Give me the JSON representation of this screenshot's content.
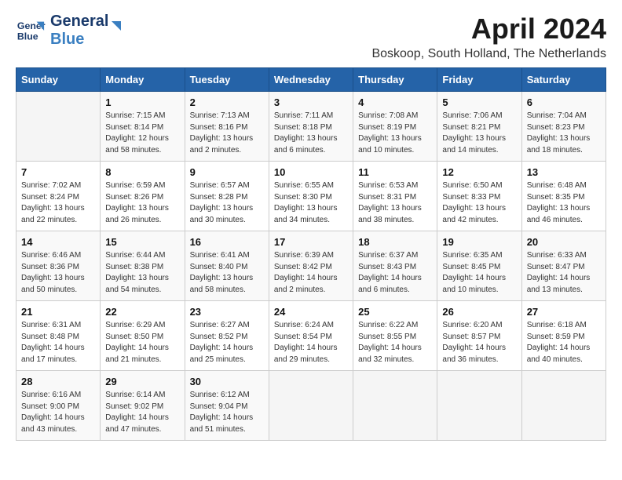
{
  "logo": {
    "line1": "General",
    "line2": "Blue"
  },
  "title": "April 2024",
  "location": "Boskoop, South Holland, The Netherlands",
  "weekdays": [
    "Sunday",
    "Monday",
    "Tuesday",
    "Wednesday",
    "Thursday",
    "Friday",
    "Saturday"
  ],
  "weeks": [
    [
      {
        "day": "",
        "sunrise": "",
        "sunset": "",
        "daylight": ""
      },
      {
        "day": "1",
        "sunrise": "Sunrise: 7:15 AM",
        "sunset": "Sunset: 8:14 PM",
        "daylight": "Daylight: 12 hours and 58 minutes."
      },
      {
        "day": "2",
        "sunrise": "Sunrise: 7:13 AM",
        "sunset": "Sunset: 8:16 PM",
        "daylight": "Daylight: 13 hours and 2 minutes."
      },
      {
        "day": "3",
        "sunrise": "Sunrise: 7:11 AM",
        "sunset": "Sunset: 8:18 PM",
        "daylight": "Daylight: 13 hours and 6 minutes."
      },
      {
        "day": "4",
        "sunrise": "Sunrise: 7:08 AM",
        "sunset": "Sunset: 8:19 PM",
        "daylight": "Daylight: 13 hours and 10 minutes."
      },
      {
        "day": "5",
        "sunrise": "Sunrise: 7:06 AM",
        "sunset": "Sunset: 8:21 PM",
        "daylight": "Daylight: 13 hours and 14 minutes."
      },
      {
        "day": "6",
        "sunrise": "Sunrise: 7:04 AM",
        "sunset": "Sunset: 8:23 PM",
        "daylight": "Daylight: 13 hours and 18 minutes."
      }
    ],
    [
      {
        "day": "7",
        "sunrise": "Sunrise: 7:02 AM",
        "sunset": "Sunset: 8:24 PM",
        "daylight": "Daylight: 13 hours and 22 minutes."
      },
      {
        "day": "8",
        "sunrise": "Sunrise: 6:59 AM",
        "sunset": "Sunset: 8:26 PM",
        "daylight": "Daylight: 13 hours and 26 minutes."
      },
      {
        "day": "9",
        "sunrise": "Sunrise: 6:57 AM",
        "sunset": "Sunset: 8:28 PM",
        "daylight": "Daylight: 13 hours and 30 minutes."
      },
      {
        "day": "10",
        "sunrise": "Sunrise: 6:55 AM",
        "sunset": "Sunset: 8:30 PM",
        "daylight": "Daylight: 13 hours and 34 minutes."
      },
      {
        "day": "11",
        "sunrise": "Sunrise: 6:53 AM",
        "sunset": "Sunset: 8:31 PM",
        "daylight": "Daylight: 13 hours and 38 minutes."
      },
      {
        "day": "12",
        "sunrise": "Sunrise: 6:50 AM",
        "sunset": "Sunset: 8:33 PM",
        "daylight": "Daylight: 13 hours and 42 minutes."
      },
      {
        "day": "13",
        "sunrise": "Sunrise: 6:48 AM",
        "sunset": "Sunset: 8:35 PM",
        "daylight": "Daylight: 13 hours and 46 minutes."
      }
    ],
    [
      {
        "day": "14",
        "sunrise": "Sunrise: 6:46 AM",
        "sunset": "Sunset: 8:36 PM",
        "daylight": "Daylight: 13 hours and 50 minutes."
      },
      {
        "day": "15",
        "sunrise": "Sunrise: 6:44 AM",
        "sunset": "Sunset: 8:38 PM",
        "daylight": "Daylight: 13 hours and 54 minutes."
      },
      {
        "day": "16",
        "sunrise": "Sunrise: 6:41 AM",
        "sunset": "Sunset: 8:40 PM",
        "daylight": "Daylight: 13 hours and 58 minutes."
      },
      {
        "day": "17",
        "sunrise": "Sunrise: 6:39 AM",
        "sunset": "Sunset: 8:42 PM",
        "daylight": "Daylight: 14 hours and 2 minutes."
      },
      {
        "day": "18",
        "sunrise": "Sunrise: 6:37 AM",
        "sunset": "Sunset: 8:43 PM",
        "daylight": "Daylight: 14 hours and 6 minutes."
      },
      {
        "day": "19",
        "sunrise": "Sunrise: 6:35 AM",
        "sunset": "Sunset: 8:45 PM",
        "daylight": "Daylight: 14 hours and 10 minutes."
      },
      {
        "day": "20",
        "sunrise": "Sunrise: 6:33 AM",
        "sunset": "Sunset: 8:47 PM",
        "daylight": "Daylight: 14 hours and 13 minutes."
      }
    ],
    [
      {
        "day": "21",
        "sunrise": "Sunrise: 6:31 AM",
        "sunset": "Sunset: 8:48 PM",
        "daylight": "Daylight: 14 hours and 17 minutes."
      },
      {
        "day": "22",
        "sunrise": "Sunrise: 6:29 AM",
        "sunset": "Sunset: 8:50 PM",
        "daylight": "Daylight: 14 hours and 21 minutes."
      },
      {
        "day": "23",
        "sunrise": "Sunrise: 6:27 AM",
        "sunset": "Sunset: 8:52 PM",
        "daylight": "Daylight: 14 hours and 25 minutes."
      },
      {
        "day": "24",
        "sunrise": "Sunrise: 6:24 AM",
        "sunset": "Sunset: 8:54 PM",
        "daylight": "Daylight: 14 hours and 29 minutes."
      },
      {
        "day": "25",
        "sunrise": "Sunrise: 6:22 AM",
        "sunset": "Sunset: 8:55 PM",
        "daylight": "Daylight: 14 hours and 32 minutes."
      },
      {
        "day": "26",
        "sunrise": "Sunrise: 6:20 AM",
        "sunset": "Sunset: 8:57 PM",
        "daylight": "Daylight: 14 hours and 36 minutes."
      },
      {
        "day": "27",
        "sunrise": "Sunrise: 6:18 AM",
        "sunset": "Sunset: 8:59 PM",
        "daylight": "Daylight: 14 hours and 40 minutes."
      }
    ],
    [
      {
        "day": "28",
        "sunrise": "Sunrise: 6:16 AM",
        "sunset": "Sunset: 9:00 PM",
        "daylight": "Daylight: 14 hours and 43 minutes."
      },
      {
        "day": "29",
        "sunrise": "Sunrise: 6:14 AM",
        "sunset": "Sunset: 9:02 PM",
        "daylight": "Daylight: 14 hours and 47 minutes."
      },
      {
        "day": "30",
        "sunrise": "Sunrise: 6:12 AM",
        "sunset": "Sunset: 9:04 PM",
        "daylight": "Daylight: 14 hours and 51 minutes."
      },
      {
        "day": "",
        "sunrise": "",
        "sunset": "",
        "daylight": ""
      },
      {
        "day": "",
        "sunrise": "",
        "sunset": "",
        "daylight": ""
      },
      {
        "day": "",
        "sunrise": "",
        "sunset": "",
        "daylight": ""
      },
      {
        "day": "",
        "sunrise": "",
        "sunset": "",
        "daylight": ""
      }
    ]
  ]
}
